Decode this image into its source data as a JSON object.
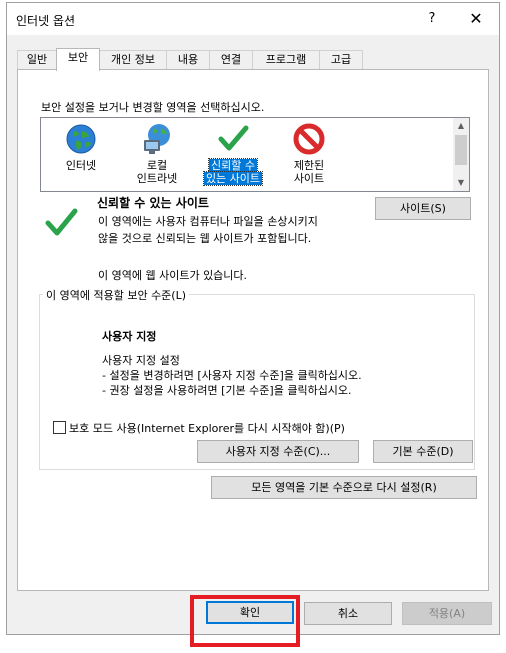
{
  "dialog": {
    "title": "인터넷 옵션",
    "help_label": "?",
    "close_label": "✕"
  },
  "tabs": [
    {
      "label": "일반"
    },
    {
      "label": "보안",
      "active": true
    },
    {
      "label": "개인 정보"
    },
    {
      "label": "내용"
    },
    {
      "label": "연결"
    },
    {
      "label": "프로그램"
    },
    {
      "label": "고급"
    }
  ],
  "security": {
    "instruction": "보안 설정을 보거나 변경할 영역을 선택하십시오.",
    "zones": [
      {
        "line1": "인터넷",
        "line2": "",
        "icon": "globe-icon"
      },
      {
        "line1": "로컬",
        "line2": "인트라넷",
        "icon": "intranet-icon"
      },
      {
        "line1": "신뢰할 수",
        "line2": "있는 사이트",
        "icon": "checkmark-icon",
        "selected": true
      },
      {
        "line1": "제한된",
        "line2": "사이트",
        "icon": "restricted-icon"
      }
    ],
    "zone_title": "신뢰할 수 있는 사이트",
    "zone_desc_line1": "이 영역에는 사용자 컴퓨터나 파일을 손상시키지",
    "zone_desc_line2": "않을 것으로 신뢰되는 웹 사이트가 포함됩니다.",
    "zone_sites_note": "이 영역에 웹 사이트가 있습니다.",
    "sites_button": "사이트(S)",
    "group_label": "이 영역에 적용할 보안 수준(L)",
    "level_title": "사용자 지정",
    "level_desc_line1": "사용자 지정 설정",
    "level_desc_line2": "- 설정을 변경하려면 [사용자 지정 수준]을 클릭하십시오.",
    "level_desc_line3": "- 권장 설정을 사용하려면 [기본 수준]을 클릭하십시오.",
    "protected_mode_label": "보호 모드 사용(Internet Explorer를 다시 시작해야 함)(P)",
    "protected_mode_checked": false,
    "custom_level_button": "사용자 지정 수준(C)...",
    "default_level_button": "기본 수준(D)",
    "reset_all_button": "모든 영역을 기본 수준으로 다시 설정(R)"
  },
  "footer": {
    "ok_label": "확인",
    "cancel_label": "취소",
    "apply_label": "적용(A)"
  },
  "colors": {
    "selection": "#0078d7",
    "highlight_box": "#e51c23",
    "dialog_bg": "#f0f0f0"
  }
}
